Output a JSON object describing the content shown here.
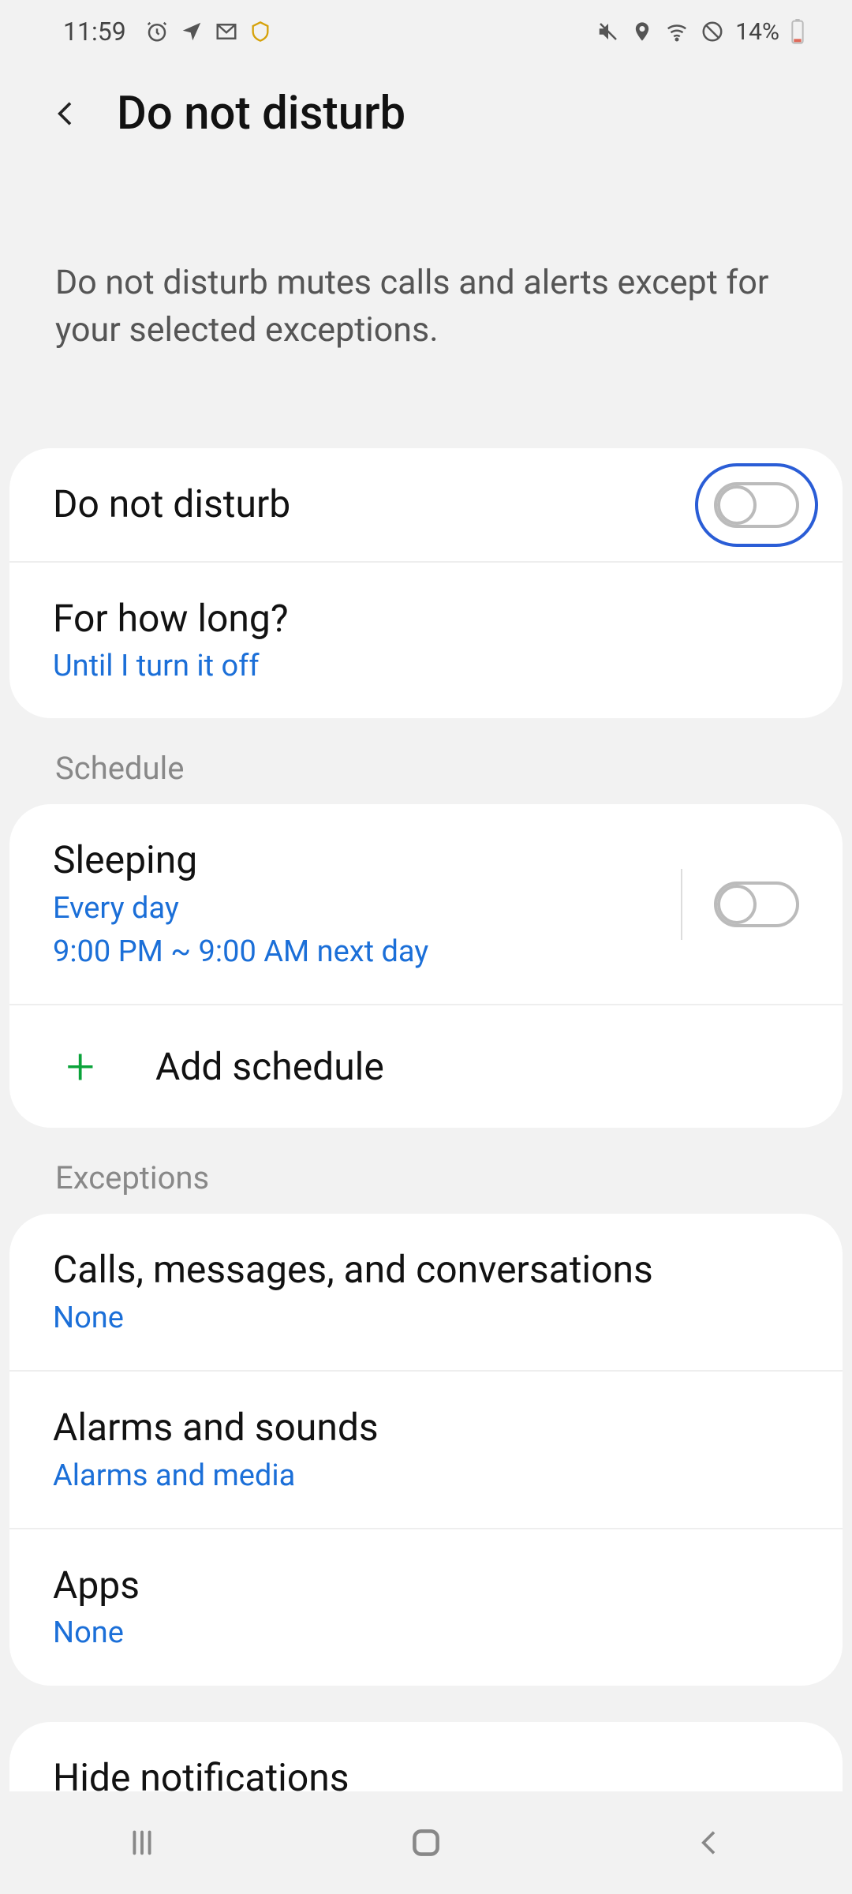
{
  "status": {
    "time": "11:59",
    "battery_pct": "14%"
  },
  "header": {
    "title": "Do not disturb"
  },
  "intro": "Do not disturb mutes calls and alerts except for your selected exceptions.",
  "main_toggle": {
    "label": "Do not disturb"
  },
  "duration": {
    "title": "For how long?",
    "value": "Until I turn it off"
  },
  "sections": {
    "schedule_label": "Schedule",
    "exceptions_label": "Exceptions"
  },
  "schedule": {
    "sleeping": {
      "title": "Sleeping",
      "repeat": "Every day",
      "time": "9:00 PM ~ 9:00 AM next day"
    },
    "add_label": "Add schedule"
  },
  "exceptions": {
    "calls": {
      "title": "Calls, messages, and conversations",
      "value": "None"
    },
    "alarms": {
      "title": "Alarms and sounds",
      "value": "Alarms and media"
    },
    "apps": {
      "title": "Apps",
      "value": "None"
    }
  },
  "hide": {
    "title": "Hide notifications"
  }
}
